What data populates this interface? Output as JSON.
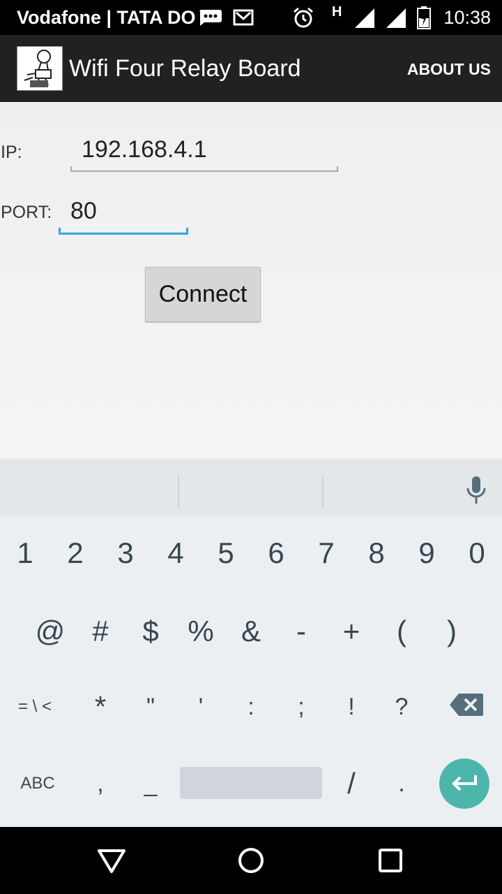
{
  "status_bar": {
    "carrier": "Vodafone | TATA DO",
    "network_type": "H",
    "time": "10:38",
    "icons": [
      "message-icon",
      "gmail-icon",
      "alarm-icon",
      "signal-icon",
      "signal-icon",
      "battery-charging-icon"
    ]
  },
  "action_bar": {
    "title": "Wifi Four Relay Board",
    "menu_item": "ABOUT US"
  },
  "form": {
    "ip_label": "IP:",
    "ip_value": "192.168.4.1",
    "port_label": "PORT:",
    "port_value": "80",
    "connect_label": "Connect"
  },
  "keyboard": {
    "row1": [
      "1",
      "2",
      "3",
      "4",
      "5",
      "6",
      "7",
      "8",
      "9",
      "0"
    ],
    "row2": [
      "@",
      "#",
      "$",
      "%",
      "&",
      "-",
      "+",
      "(",
      ")"
    ],
    "row3": [
      "= \\ <",
      "*",
      "\"",
      "'",
      ":",
      ";",
      "!",
      "?"
    ],
    "row4": [
      "ABC",
      ",",
      "_",
      "/",
      "."
    ],
    "accent_color": "#4db6ac"
  }
}
